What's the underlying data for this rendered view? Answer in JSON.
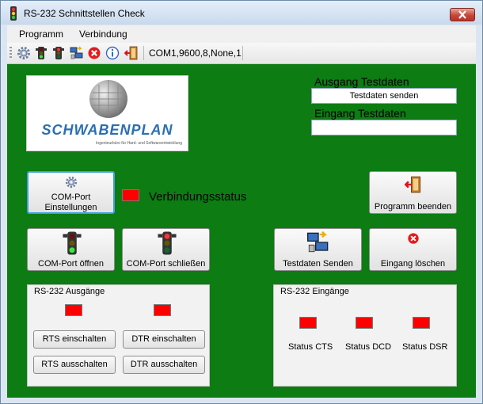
{
  "window": {
    "title": "RS-232 Schnittstellen Check"
  },
  "menu": {
    "items": [
      "Programm",
      "Verbindung"
    ]
  },
  "toolbar": {
    "icons": [
      "gear-icon",
      "traffic-light-green-icon",
      "traffic-light-red-icon",
      "send-data-icon",
      "clear-icon",
      "info-icon",
      "exit-icon"
    ],
    "status": "COM1,9600,8,None,1"
  },
  "logo": {
    "text": "SCHWABENPLAN",
    "subtitle": "Ingenieurbüro für Hard- und Softwareentwicklung"
  },
  "output_data": {
    "label": "Ausgang Testdaten",
    "value": "Testdaten senden"
  },
  "input_data": {
    "label": "Eingang Testdaten",
    "value": ""
  },
  "connection": {
    "label": "Verbindungsstatus",
    "led_color": "#ff0000"
  },
  "buttons": {
    "com_settings": "COM-Port\nEinstellungen",
    "exit": "Programm beenden",
    "com_open": "COM-Port öffnen",
    "com_close": "COM-Port schließen",
    "send_test": "Testdaten Senden",
    "clear_input": "Eingang löschen"
  },
  "outputs_group": {
    "title": "RS-232 Ausgänge",
    "rts_on": "RTS einschalten",
    "dtr_on": "DTR einschalten",
    "rts_off": "RTS ausschalten",
    "dtr_off": "DTR ausschalten"
  },
  "inputs_group": {
    "title": "RS-232 Eingänge",
    "cts": "Status CTS",
    "dcd": "Status DCD",
    "dsr": "Status DSR"
  },
  "colors": {
    "background": "#0c7c13",
    "led_off": "#ff0000"
  }
}
